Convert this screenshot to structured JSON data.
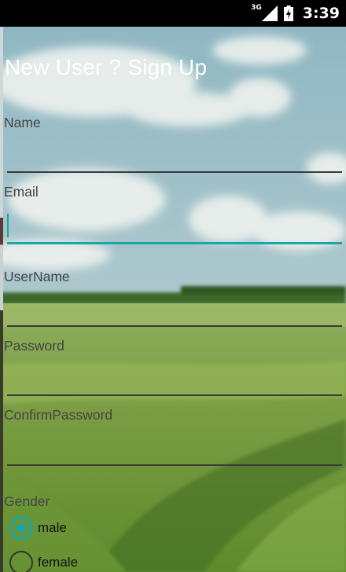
{
  "status_bar": {
    "network": "3G",
    "time": "3:39"
  },
  "form": {
    "title": "New User ? Sign Up",
    "fields": {
      "name": {
        "label": "Name",
        "value": ""
      },
      "email": {
        "label": "Email",
        "value": ""
      },
      "username": {
        "label": "UserName",
        "value": ""
      },
      "password": {
        "label": "Password",
        "value": ""
      },
      "confirm_password": {
        "label": "ConfirmPassword",
        "value": ""
      }
    },
    "gender": {
      "label": "Gender",
      "options": [
        {
          "label": "male",
          "selected": true
        },
        {
          "label": "female",
          "selected": false
        }
      ]
    }
  },
  "colors": {
    "accent": "#1aa6a6",
    "status_bar": "#000000",
    "title_text": "#ffffff"
  }
}
